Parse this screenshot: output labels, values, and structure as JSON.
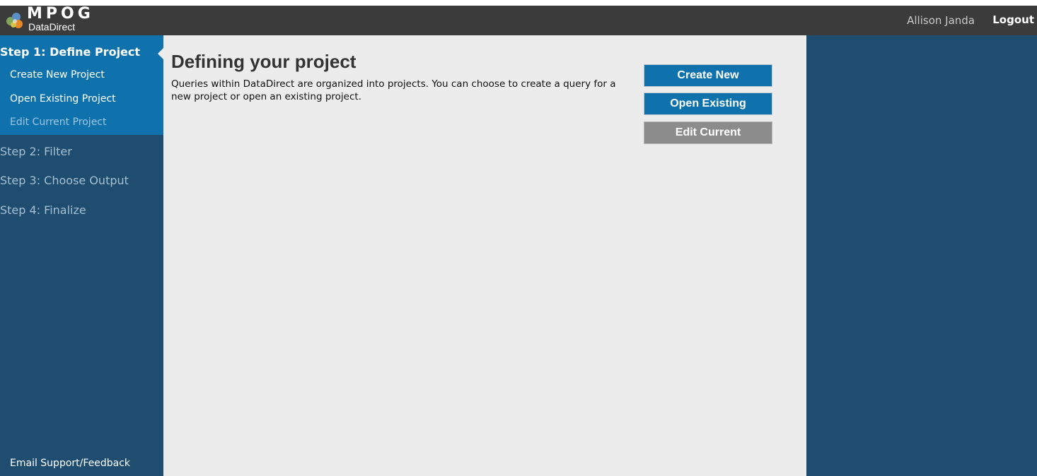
{
  "colors": {
    "header_bg": "#3b3b3b",
    "sidebar_bg": "#1e4d6f",
    "active_step_bg": "#0f72ac",
    "main_bg": "#ececec",
    "primary_button": "#0f72ac",
    "disabled_button": "#8c8c8c"
  },
  "header": {
    "logo": {
      "mark": "MPOG",
      "subtitle": "DataDirect",
      "icon": "mpog-logo-icon"
    },
    "user_name": "Allison Janda",
    "logout_label": "Logout"
  },
  "sidebar": {
    "active_step": {
      "title": "Step 1: Define Project",
      "items": [
        {
          "label": "Create New Project",
          "enabled": true
        },
        {
          "label": "Open Existing Project",
          "enabled": true
        },
        {
          "label": "Edit Current Project",
          "enabled": false
        }
      ]
    },
    "steps": [
      {
        "label": "Step 2: Filter"
      },
      {
        "label": "Step 3: Choose Output"
      },
      {
        "label": "Step 4: Finalize"
      }
    ],
    "footer_link": "Email Support/Feedback"
  },
  "main": {
    "title": "Defining your project",
    "description": "Queries within DataDirect are organized into projects. You can choose to create a query for a new project or open an existing project.",
    "buttons": {
      "create_new": "Create New",
      "open_existing": "Open Existing",
      "edit_current": "Edit Current"
    }
  }
}
